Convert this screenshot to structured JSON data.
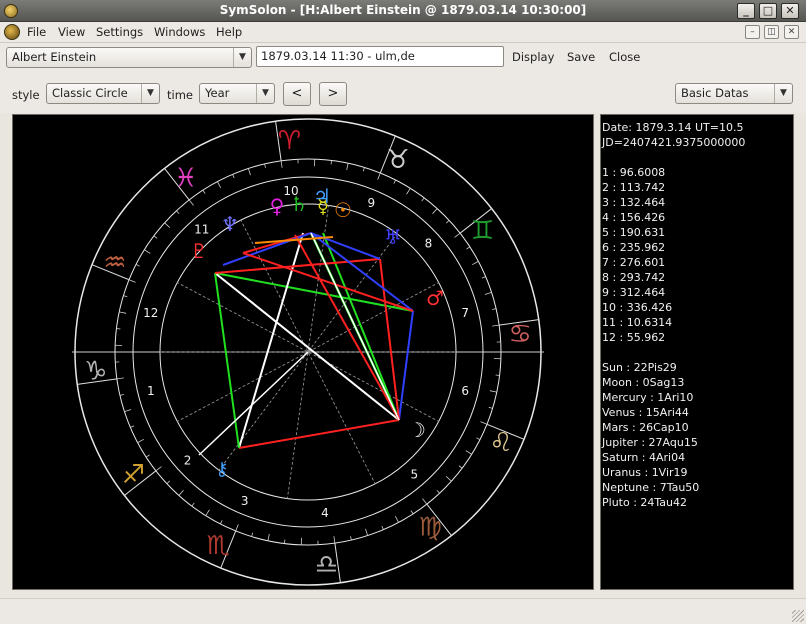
{
  "window": {
    "title": "SymSolon - [H:Albert Einstein @ 1879.03.14 10:30:00]"
  },
  "menu": [
    "File",
    "View",
    "Settings",
    "Windows",
    "Help"
  ],
  "toolbar": {
    "person": "Albert Einstein",
    "datetime": "1879.03.14 11:30 - ulm,de",
    "display_label": "Display",
    "save_label": "Save",
    "close_label": "Close"
  },
  "controls": {
    "style_label": "style",
    "style_value": "Classic Circle",
    "time_label": "time",
    "time_value": "Year",
    "prev_label": "<",
    "next_label": ">",
    "data_select": "Basic Datas"
  },
  "chart": {
    "zodiac": [
      {
        "glyph": "♈",
        "color": "#cc1e2e"
      },
      {
        "glyph": "♉",
        "color": "#cfcfcf"
      },
      {
        "glyph": "♊",
        "color": "#1e9a2e"
      },
      {
        "glyph": "♋",
        "color": "#d06060"
      },
      {
        "glyph": "♌",
        "color": "#e0c890"
      },
      {
        "glyph": "♍",
        "color": "#9a5a3a"
      },
      {
        "glyph": "♎",
        "color": "#b0b0b0"
      },
      {
        "glyph": "♏",
        "color": "#b03a32"
      },
      {
        "glyph": "♐",
        "color": "#d0a030"
      },
      {
        "glyph": "♑",
        "color": "#b4b4b4"
      },
      {
        "glyph": "♒",
        "color": "#c06040"
      },
      {
        "glyph": "♓",
        "color": "#e040c0"
      }
    ],
    "house_numbers": [
      "1",
      "2",
      "3",
      "4",
      "5",
      "6",
      "7",
      "8",
      "9",
      "10",
      "11",
      "12"
    ],
    "planets": [
      {
        "name": "Sun",
        "glyph": "☉",
        "color": "#ff8a00"
      },
      {
        "name": "Mercury",
        "glyph": "☿",
        "color": "#e0e020"
      },
      {
        "name": "Saturn",
        "glyph": "♄",
        "color": "#20c020"
      },
      {
        "name": "Venus",
        "glyph": "♀",
        "color": "#e020e0"
      },
      {
        "name": "Neptune",
        "glyph": "♆",
        "color": "#7070ff"
      },
      {
        "name": "Pluto",
        "glyph": "♇",
        "color": "#ff3030"
      },
      {
        "name": "Mars",
        "glyph": "♂",
        "color": "#ff3030"
      },
      {
        "name": "Uranus",
        "glyph": "♅",
        "color": "#4040ff"
      },
      {
        "name": "Jupiter",
        "glyph": "♃",
        "color": "#40a0ff"
      },
      {
        "name": "Moon",
        "glyph": "☽",
        "color": "#f0f0f0"
      }
    ]
  },
  "info": {
    "date": "Date: 1879.3.14 UT=10.5",
    "jd": "JD=2407421.9375000000",
    "houses": [
      "1 : 96.6008",
      "2 : 113.742",
      "3 : 132.464",
      "4 : 156.426",
      "5 : 190.631",
      "6 : 235.962",
      "7 : 276.601",
      "8 : 293.742",
      "9 : 312.464",
      "10 : 336.426",
      "11 : 10.6314",
      "12 : 55.962"
    ],
    "positions": [
      "Sun : 22Pis29",
      "Moon : 0Sag13",
      "Mercury : 1Ari10",
      "Venus : 15Ari44",
      "Mars : 26Cap10",
      "Jupiter : 27Aqu15",
      "Saturn : 4Ari04",
      "Uranus : 1Vir19",
      "Neptune : 7Tau50",
      "Pluto : 24Tau42"
    ]
  },
  "colors": {
    "aspect_red": "#ff2020",
    "aspect_green": "#20e020",
    "aspect_blue": "#3040ff",
    "aspect_white": "#ffffff"
  }
}
